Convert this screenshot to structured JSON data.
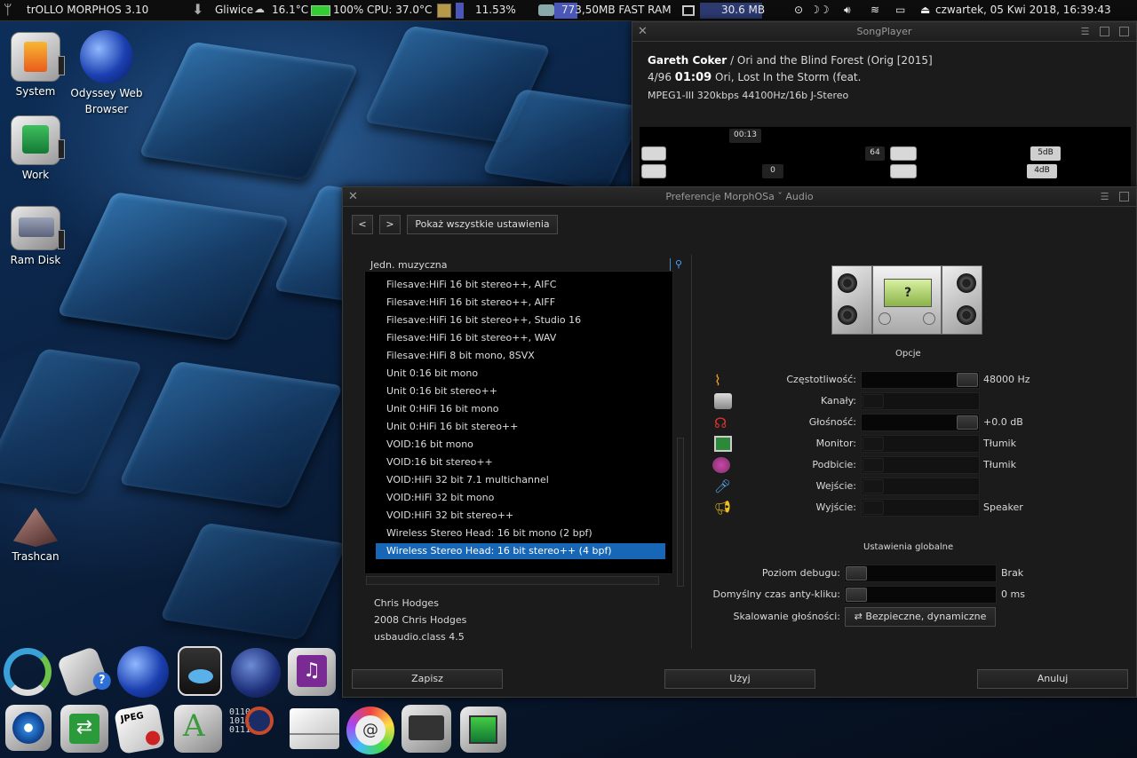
{
  "topbar": {
    "app_title": "trOLLO MORPHOS 3.10",
    "city": "Gliwice",
    "temperature": "16.1°C",
    "battery": "100%",
    "cpu_label": "CPU: 37.0°C",
    "cpu_usage": "11.53%",
    "fast_ram": "773,50MB FAST RAM",
    "chip_mem": "30.6 MB",
    "clock": "czwartek, 05 Kwi 2018, 16:39:43"
  },
  "desktop": {
    "icons": [
      {
        "label": "System"
      },
      {
        "label": "Odyssey Web Browser"
      },
      {
        "label": "Work"
      },
      {
        "label": "Ram Disk"
      },
      {
        "label": "Trashcan"
      }
    ]
  },
  "songplayer": {
    "title": "SongPlayer",
    "artist": "Gareth Coker",
    "album": "/ Ori and the Blind Forest (Orig [2015]",
    "track_pos": "4/96",
    "time": "01:09",
    "track_title": "Ori, Lost In the Storm (feat.",
    "format": "MPEG1-III 320kbps  44100Hz/16b J-Stereo",
    "elapsed": "00:13",
    "vol_val": "64",
    "balance_val": "0",
    "treble_val": "5dB",
    "bass_val": "4dB"
  },
  "prefs": {
    "title": "Preferencje MorphOSa ˇ Audio",
    "nav_back": "<",
    "nav_fwd": ">",
    "show_all": "Pokaż wszystkie ustawienia",
    "list_header": "Jedn. muzyczna",
    "list_items": [
      "Filesave:HiFi 16 bit stereo++, AIFC",
      "Filesave:HiFi 16 bit stereo++, AIFF",
      "Filesave:HiFi 16 bit stereo++, Studio 16",
      "Filesave:HiFi 16 bit stereo++, WAV",
      "Filesave:HiFi 8 bit mono, 8SVX",
      "Unit 0:16 bit mono",
      "Unit 0:16 bit stereo++",
      "Unit 0:HiFi 16 bit mono",
      "Unit 0:HiFi 16 bit stereo++",
      "VOID:16 bit mono",
      "VOID:16 bit stereo++",
      "VOID:HiFi 32 bit 7.1 multichannel",
      "VOID:HiFi 32 bit mono",
      "VOID:HiFi 32 bit stereo++",
      "Wireless Stereo Head: 16 bit mono (2 bpf)",
      "Wireless Stereo Head: 16 bit stereo++ (4 bpf)"
    ],
    "selected_index": 15,
    "info": {
      "author": "Chris Hodges",
      "copyright": "2008 Chris Hodges",
      "version": "usbaudio.class 4.5"
    },
    "options_title": "Opcje",
    "options": [
      {
        "label": "Częstotliwość:",
        "value": "48000 Hz",
        "icon": "waveform-icon"
      },
      {
        "label": "Kanały:",
        "value": "",
        "icon": "speaker-icon"
      },
      {
        "label": "Głośność:",
        "value": "+0.0 dB",
        "icon": "headphones-icon"
      },
      {
        "label": "Monitor:",
        "value": "Tłumik",
        "icon": "monitor-icon"
      },
      {
        "label": "Podbicie:",
        "value": "Tłumik",
        "icon": "boost-icon"
      },
      {
        "label": "Wejście:",
        "value": "",
        "icon": "microphone-icon"
      },
      {
        "label": "Wyjście:",
        "value": "Speaker",
        "icon": "loudspeaker-icon"
      }
    ],
    "global_title": "Ustawienia globalne",
    "debug_label": "Poziom debugu:",
    "debug_value": "Brak",
    "anticlick_label": "Domyślny czas anty-kliku:",
    "anticlick_value": "0 ms",
    "scaling_label": "Skalowanie głośności:",
    "scaling_value": "⇄ Bezpieczne, dynamiczne",
    "save": "Zapisz",
    "use": "Użyj",
    "cancel": "Anuluj"
  }
}
